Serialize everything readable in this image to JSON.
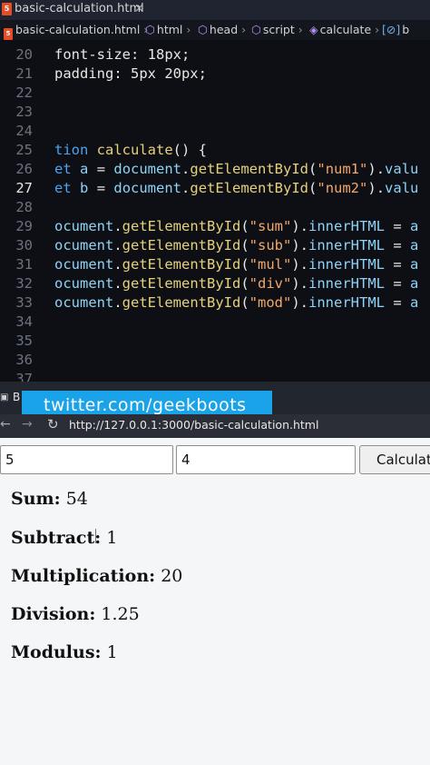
{
  "editor": {
    "tab_title": "basic-calculation.html",
    "tab_close": "×",
    "breadcrumb": [
      "basic-calculation.html",
      "html",
      "head",
      "script",
      "calculate",
      "b"
    ],
    "lines": [
      {
        "n": "20",
        "code": "font-size: 18px;"
      },
      {
        "n": "21",
        "code": "padding: 5px 20px;"
      },
      {
        "n": "22",
        "code": ""
      },
      {
        "n": "23",
        "code": ""
      },
      {
        "n": "24",
        "code": ""
      },
      {
        "n": "25",
        "code": "tion calculate() {"
      },
      {
        "n": "26",
        "code": "et a = document.getElementById(\"num1\").valu"
      },
      {
        "n": "27",
        "code": "et b = document.getElementById(\"num2\").valu"
      },
      {
        "n": "28",
        "code": ""
      },
      {
        "n": "29",
        "code": "ocument.getElementById(\"sum\").innerHTML = a"
      },
      {
        "n": "30",
        "code": "ocument.getElementById(\"sub\").innerHTML = a"
      },
      {
        "n": "31",
        "code": "ocument.getElementById(\"mul\").innerHTML = a"
      },
      {
        "n": "32",
        "code": "ocument.getElementById(\"div\").innerHTML = a"
      },
      {
        "n": "33",
        "code": "ocument.getElementById(\"mod\").innerHTML = a"
      },
      {
        "n": "34",
        "code": ""
      },
      {
        "n": "35",
        "code": ""
      },
      {
        "n": "36",
        "code": ""
      },
      {
        "n": "37",
        "code": ""
      }
    ],
    "active_line": "27"
  },
  "browser": {
    "tab_label": "B",
    "watermark": "twitter.com/geekboots",
    "url": "http://127.0.0.1:3000/basic-calculation.html"
  },
  "calculator": {
    "num1_value": "5",
    "num2_value": "4",
    "button_label": "Calculate",
    "results": [
      {
        "label": "Sum:",
        "value": "54"
      },
      {
        "label": "Subtract:",
        "value": "1"
      },
      {
        "label": "Multiplication:",
        "value": "20"
      },
      {
        "label": "Division:",
        "value": "1.25"
      },
      {
        "label": "Modulus:",
        "value": "1"
      }
    ]
  },
  "colors": {
    "editor_bg": "#0d0f14",
    "keyword": "#4aa3f0",
    "function": "#e6d17a",
    "string": "#f2a76b",
    "watermark_bg": "#1aa3e8",
    "html_icon": "#e44d26"
  }
}
